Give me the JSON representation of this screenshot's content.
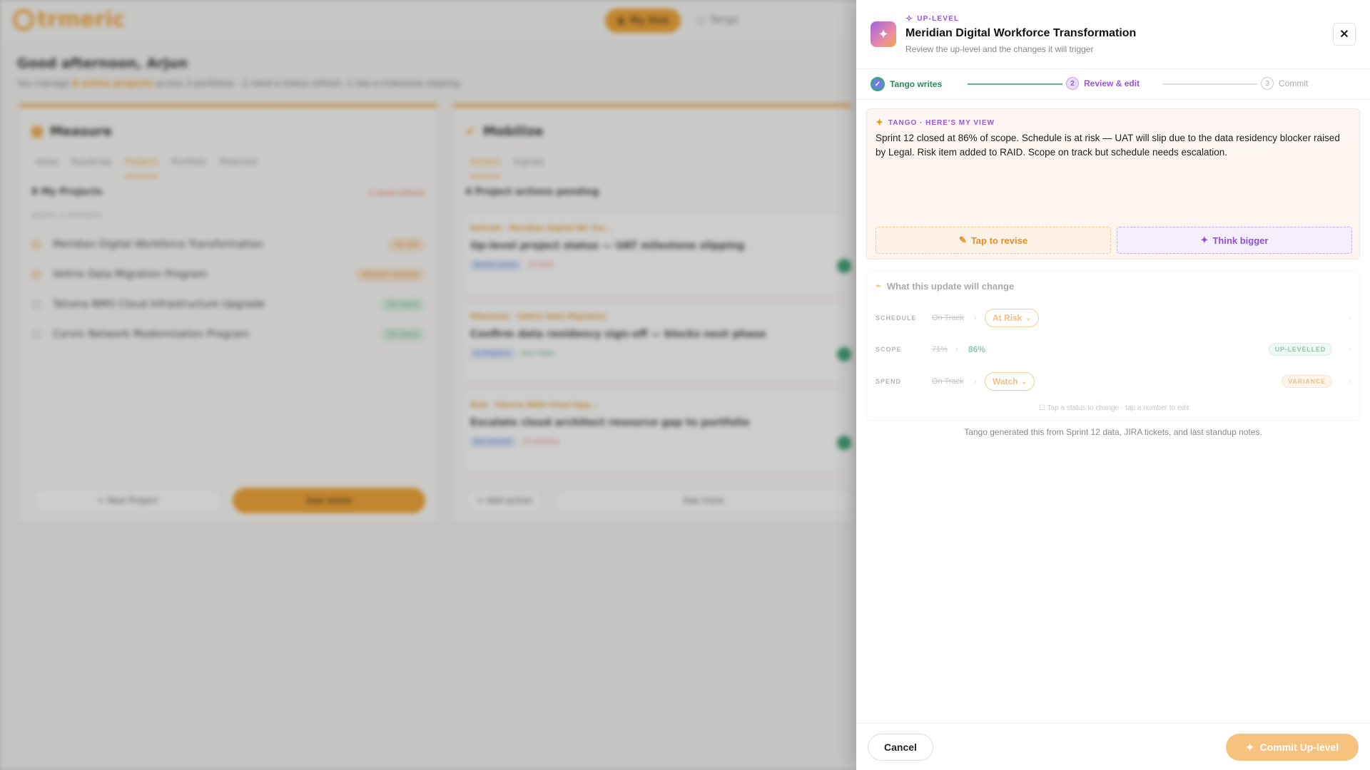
{
  "background": {
    "brand": "trmeric",
    "nav": {
      "my_hub": "My Hub",
      "tango": "Tango"
    },
    "greeting": "Good afternoon, Arjun",
    "summary_prefix": "You manage",
    "summary_highlight": "8 active projects",
    "summary_rest": "across 3 portfolios · 2 need a status refresh, 1 has a milestone slipping.",
    "measure": {
      "title": "Measure",
      "tabs": [
        "Ideas",
        "Roadmap",
        "Projects",
        "Portfolio",
        "Potential"
      ],
      "section_title": "8 My Projects",
      "section_flag": "2 need refresh",
      "subheading": "NEEDS A REFRESH",
      "rows": [
        {
          "name": "Meridian Digital Workforce Transformation",
          "badge": "At risk"
        },
        {
          "name": "Veltrix Data Migration Program",
          "badge": "Refresh needed"
        },
        {
          "name": "Talvera NMO Cloud Infrastructure Upgrade",
          "badge": "On track"
        },
        {
          "name": "Corvin Network Modernisation Program",
          "badge": "On track"
        }
      ],
      "new_project": "+ New Project",
      "see_more": "See more"
    },
    "mobilize": {
      "title": "Mobilize",
      "tabs": [
        "Actions",
        "Signals"
      ],
      "section_title": "4 Project actions pending",
      "actions": [
        {
          "tag": "Refresh · Meridian Digital WF Tra...",
          "title": "Up-level project status — UAT milestone slipping",
          "chip1": "Needs action",
          "chip2": "1d stale"
        },
        {
          "tag": "Milestone · Veltrix Data Migration",
          "title": "Confirm data residency sign-off — blocks next phase",
          "chip1": "In Progress",
          "chip2": "Due today"
        },
        {
          "tag": "Risk · Talvera NMO Cloud Upg...",
          "title": "Escalate cloud architect resource gap to portfolio",
          "chip1": "Not started",
          "chip2": "1d overdue"
        }
      ],
      "add_action": "+ Add action",
      "see_more": "See more"
    }
  },
  "drawer": {
    "eyebrow": "UP-LEVEL",
    "title": "Meridian Digital Workforce Transformation",
    "subtitle": "Review the up-level and the changes it will trigger",
    "close_glyph": "✕",
    "steps": [
      {
        "number": "✓",
        "label": "Tango writes"
      },
      {
        "number": "2",
        "label": "Review & edit"
      },
      {
        "number": "3",
        "label": "Commit"
      }
    ],
    "view": {
      "tag": "TANGO · HERE'S MY VIEW",
      "text": "Sprint 12 closed at 86% of scope. Schedule is at risk — UAT will slip due to the data residency blocker raised by Legal. Risk item added to RAID. Scope on track but schedule needs escalation.",
      "revise_label": "Tap to revise",
      "bigger_label": "Think bigger"
    },
    "changes": {
      "heading": "What this update will change",
      "rows": [
        {
          "label": "SCHEDULE",
          "old": "On Track",
          "new": "At Risk",
          "badge": ""
        },
        {
          "label": "SCOPE",
          "old": "71%",
          "new": "86%",
          "badge": "UP-LEVELLED"
        },
        {
          "label": "SPEND",
          "old": "On Track",
          "new": "Watch",
          "badge": "VARIANCE"
        }
      ],
      "hint": "Tap a status to change · tap a number to edit"
    },
    "footnote": "Tango generated this from Sprint 12 data, JIRA tickets, and last standup notes.",
    "cancel_label": "Cancel",
    "commit_label": "Commit Up-level"
  },
  "colors": {
    "accent_orange": "#ee9a1c",
    "accent_purple": "#9a55d8",
    "success_green": "#2e9a6a"
  }
}
